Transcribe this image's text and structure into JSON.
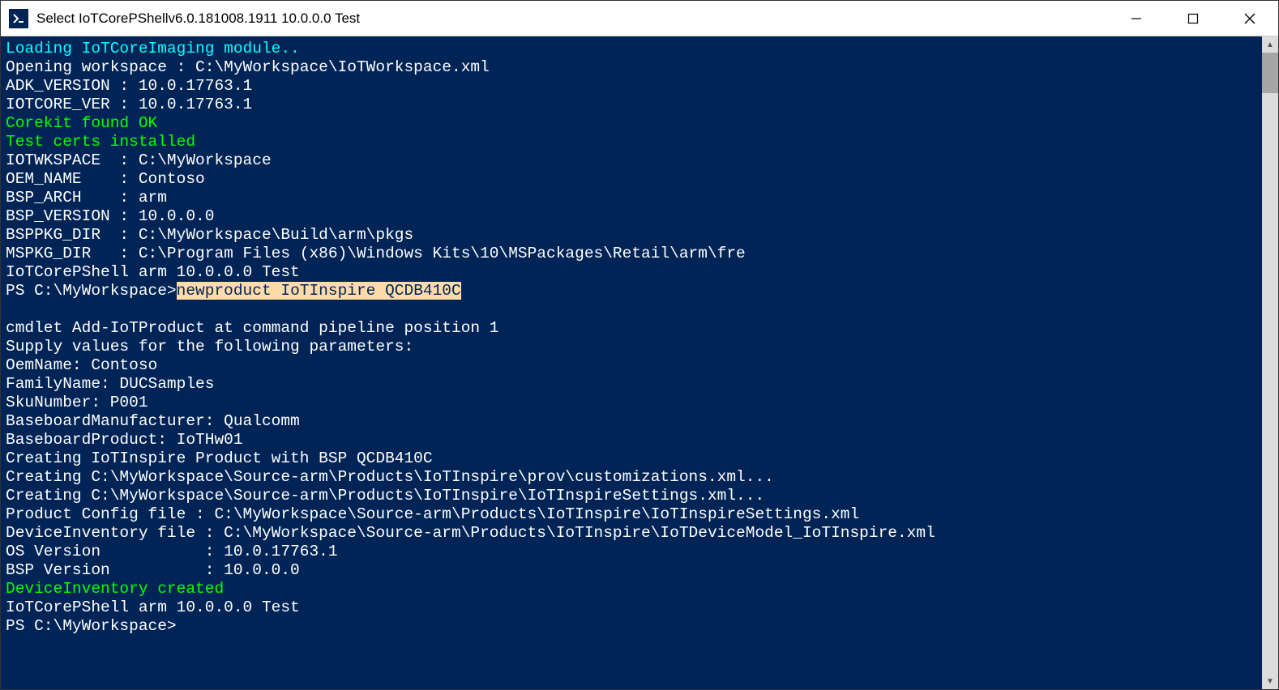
{
  "window": {
    "title": "Select IoTCorePShellv6.0.181008.1911 10.0.0.0 Test"
  },
  "lines": {
    "loading": "Loading IoTCoreImaging module..",
    "opening": "Opening workspace : C:\\MyWorkspace\\IoTWorkspace.xml",
    "adk": "ADK_VERSION : 10.0.17763.1",
    "iotcore": "IOTCORE_VER : 10.0.17763.1",
    "corekit": "Corekit found OK",
    "certs": "Test certs installed",
    "wkspace": "IOTWKSPACE  : C:\\MyWorkspace",
    "oem": "OEM_NAME    : Contoso",
    "arch": "BSP_ARCH    : arm",
    "bspver": "BSP_VERSION : 10.0.0.0",
    "bsppkg": "BSPPKG_DIR  : C:\\MyWorkspace\\Build\\arm\\pkgs",
    "mspkg": "MSPKG_DIR   : C:\\Program Files (x86)\\Windows Kits\\10\\MSPackages\\Retail\\arm\\fre",
    "shell1": "IoTCorePShell arm 10.0.0.0 Test",
    "prompt1": "PS C:\\MyWorkspace>",
    "cmd_highlight": "newproduct IoTInspire QCDB410C",
    "blank": "",
    "cmdlet": "cmdlet Add-IoTProduct at command pipeline position 1",
    "supply": "Supply values for the following parameters:",
    "oemname": "OemName: Contoso",
    "family": "FamilyName: DUCSamples",
    "sku": "SkuNumber: P001",
    "bbmfr": "BaseboardManufacturer: Qualcomm",
    "bbprod": "BaseboardProduct: IoTHw01",
    "creating1": "Creating IoTInspire Product with BSP QCDB410C",
    "creating2": "Creating C:\\MyWorkspace\\Source-arm\\Products\\IoTInspire\\prov\\customizations.xml...",
    "creating3": "Creating C:\\MyWorkspace\\Source-arm\\Products\\IoTInspire\\IoTInspireSettings.xml...",
    "prodcfg": "Product Config file : C:\\MyWorkspace\\Source-arm\\Products\\IoTInspire\\IoTInspireSettings.xml",
    "devinv": "DeviceInventory file : C:\\MyWorkspace\\Source-arm\\Products\\IoTInspire\\IoTDeviceModel_IoTInspire.xml",
    "osver": "OS Version           : 10.0.17763.1",
    "bspver2": "BSP Version          : 10.0.0.0",
    "devcreated": "DeviceInventory created",
    "shell2": "IoTCorePShell arm 10.0.0.0 Test",
    "prompt2": "PS C:\\MyWorkspace>"
  }
}
